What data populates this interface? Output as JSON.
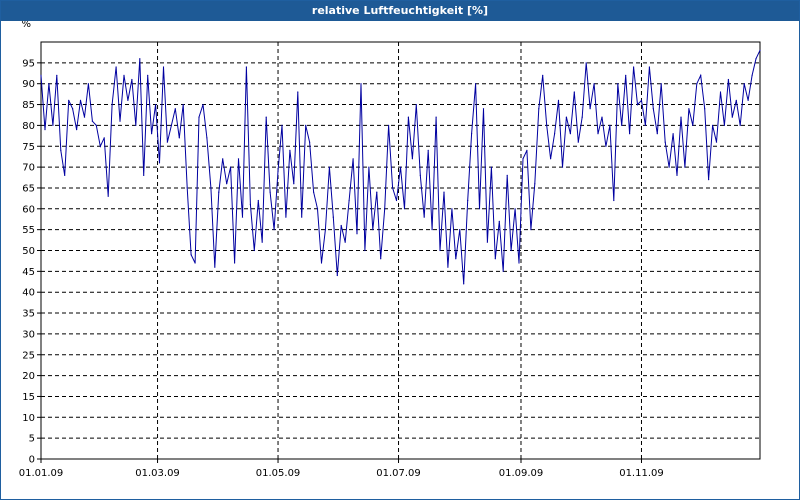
{
  "window": {
    "title": "relative Luftfeuchtigkeit [%]"
  },
  "chart_data": {
    "type": "line",
    "title": "relative Luftfeuchtigkeit [%]",
    "ylabel": "%",
    "xlabel": "",
    "ylim": [
      0,
      100
    ],
    "yticks": [
      0,
      5,
      10,
      15,
      20,
      25,
      30,
      35,
      40,
      45,
      50,
      55,
      60,
      65,
      70,
      75,
      80,
      85,
      90,
      95
    ],
    "xlim": [
      "2009-01-01",
      "2009-12-31"
    ],
    "xticks": [
      {
        "date": "2009-01-01",
        "label": "01.01.09"
      },
      {
        "date": "2009-03-01",
        "label": "01.03.09"
      },
      {
        "date": "2009-05-01",
        "label": "01.05.09"
      },
      {
        "date": "2009-07-01",
        "label": "01.07.09"
      },
      {
        "date": "2009-09-01",
        "label": "01.09.09"
      },
      {
        "date": "2009-11-01",
        "label": "01.11.09"
      }
    ],
    "grid": {
      "horizontal": true,
      "vertical": true,
      "style": "dashed"
    },
    "line_color": "#0000a0",
    "series": [
      {
        "values": [
          [
            "2009-01-01",
            92
          ],
          [
            "2009-01-03",
            79
          ],
          [
            "2009-01-05",
            90
          ],
          [
            "2009-01-07",
            80
          ],
          [
            "2009-01-09",
            92
          ],
          [
            "2009-01-11",
            74
          ],
          [
            "2009-01-13",
            68
          ],
          [
            "2009-01-15",
            86
          ],
          [
            "2009-01-17",
            84
          ],
          [
            "2009-01-19",
            79
          ],
          [
            "2009-01-21",
            86
          ],
          [
            "2009-01-23",
            82
          ],
          [
            "2009-01-25",
            90
          ],
          [
            "2009-01-27",
            81
          ],
          [
            "2009-01-29",
            80
          ],
          [
            "2009-01-31",
            75
          ],
          [
            "2009-02-02",
            77
          ],
          [
            "2009-02-04",
            63
          ],
          [
            "2009-02-06",
            85
          ],
          [
            "2009-02-08",
            94
          ],
          [
            "2009-02-10",
            81
          ],
          [
            "2009-02-12",
            92
          ],
          [
            "2009-02-14",
            86
          ],
          [
            "2009-02-16",
            91
          ],
          [
            "2009-02-18",
            80
          ],
          [
            "2009-02-20",
            96
          ],
          [
            "2009-02-22",
            68
          ],
          [
            "2009-02-24",
            92
          ],
          [
            "2009-02-26",
            78
          ],
          [
            "2009-02-28",
            85
          ],
          [
            "2009-03-02",
            71
          ],
          [
            "2009-03-04",
            94
          ],
          [
            "2009-03-06",
            76
          ],
          [
            "2009-03-08",
            80
          ],
          [
            "2009-03-10",
            84
          ],
          [
            "2009-03-12",
            77
          ],
          [
            "2009-03-14",
            85
          ],
          [
            "2009-03-16",
            65
          ],
          [
            "2009-03-18",
            49
          ],
          [
            "2009-03-20",
            47
          ],
          [
            "2009-03-22",
            82
          ],
          [
            "2009-03-24",
            85
          ],
          [
            "2009-03-26",
            77
          ],
          [
            "2009-03-28",
            65
          ],
          [
            "2009-03-30",
            46
          ],
          [
            "2009-04-01",
            64
          ],
          [
            "2009-04-03",
            72
          ],
          [
            "2009-04-05",
            66
          ],
          [
            "2009-04-07",
            70
          ],
          [
            "2009-04-09",
            47
          ],
          [
            "2009-04-11",
            72
          ],
          [
            "2009-04-13",
            58
          ],
          [
            "2009-04-15",
            94
          ],
          [
            "2009-04-17",
            61
          ],
          [
            "2009-04-19",
            50
          ],
          [
            "2009-04-21",
            62
          ],
          [
            "2009-04-23",
            52
          ],
          [
            "2009-04-25",
            82
          ],
          [
            "2009-04-27",
            64
          ],
          [
            "2009-04-29",
            55
          ],
          [
            "2009-05-01",
            69
          ],
          [
            "2009-05-03",
            80
          ],
          [
            "2009-05-05",
            58
          ],
          [
            "2009-05-07",
            74
          ],
          [
            "2009-05-09",
            66
          ],
          [
            "2009-05-11",
            88
          ],
          [
            "2009-05-13",
            58
          ],
          [
            "2009-05-15",
            80
          ],
          [
            "2009-05-17",
            76
          ],
          [
            "2009-05-19",
            64
          ],
          [
            "2009-05-21",
            60
          ],
          [
            "2009-05-23",
            47
          ],
          [
            "2009-05-25",
            55
          ],
          [
            "2009-05-27",
            70
          ],
          [
            "2009-05-29",
            58
          ],
          [
            "2009-05-31",
            44
          ],
          [
            "2009-06-02",
            56
          ],
          [
            "2009-06-04",
            52
          ],
          [
            "2009-06-06",
            62
          ],
          [
            "2009-06-08",
            72
          ],
          [
            "2009-06-10",
            54
          ],
          [
            "2009-06-12",
            90
          ],
          [
            "2009-06-14",
            50
          ],
          [
            "2009-06-16",
            70
          ],
          [
            "2009-06-18",
            55
          ],
          [
            "2009-06-20",
            64
          ],
          [
            "2009-06-22",
            48
          ],
          [
            "2009-06-24",
            60
          ],
          [
            "2009-06-26",
            80
          ],
          [
            "2009-06-28",
            65
          ],
          [
            "2009-06-30",
            62
          ],
          [
            "2009-07-02",
            70
          ],
          [
            "2009-07-04",
            60
          ],
          [
            "2009-07-06",
            82
          ],
          [
            "2009-07-08",
            72
          ],
          [
            "2009-07-10",
            85
          ],
          [
            "2009-07-12",
            68
          ],
          [
            "2009-07-14",
            58
          ],
          [
            "2009-07-16",
            74
          ],
          [
            "2009-07-18",
            55
          ],
          [
            "2009-07-20",
            82
          ],
          [
            "2009-07-22",
            50
          ],
          [
            "2009-07-24",
            64
          ],
          [
            "2009-07-26",
            46
          ],
          [
            "2009-07-28",
            60
          ],
          [
            "2009-07-30",
            48
          ],
          [
            "2009-08-01",
            55
          ],
          [
            "2009-08-03",
            42
          ],
          [
            "2009-08-05",
            62
          ],
          [
            "2009-08-07",
            78
          ],
          [
            "2009-08-09",
            90
          ],
          [
            "2009-08-11",
            60
          ],
          [
            "2009-08-13",
            84
          ],
          [
            "2009-08-15",
            52
          ],
          [
            "2009-08-17",
            70
          ],
          [
            "2009-08-19",
            48
          ],
          [
            "2009-08-21",
            57
          ],
          [
            "2009-08-23",
            45
          ],
          [
            "2009-08-25",
            68
          ],
          [
            "2009-08-27",
            50
          ],
          [
            "2009-08-29",
            60
          ],
          [
            "2009-08-31",
            47
          ],
          [
            "2009-09-02",
            72
          ],
          [
            "2009-09-04",
            74
          ],
          [
            "2009-09-06",
            55
          ],
          [
            "2009-09-08",
            66
          ],
          [
            "2009-09-10",
            84
          ],
          [
            "2009-09-12",
            92
          ],
          [
            "2009-09-14",
            80
          ],
          [
            "2009-09-16",
            72
          ],
          [
            "2009-09-18",
            78
          ],
          [
            "2009-09-20",
            86
          ],
          [
            "2009-09-22",
            70
          ],
          [
            "2009-09-24",
            82
          ],
          [
            "2009-09-26",
            78
          ],
          [
            "2009-09-28",
            88
          ],
          [
            "2009-09-30",
            76
          ],
          [
            "2009-10-02",
            82
          ],
          [
            "2009-10-04",
            95
          ],
          [
            "2009-10-06",
            84
          ],
          [
            "2009-10-08",
            90
          ],
          [
            "2009-10-10",
            78
          ],
          [
            "2009-10-12",
            82
          ],
          [
            "2009-10-14",
            75
          ],
          [
            "2009-10-16",
            80
          ],
          [
            "2009-10-18",
            62
          ],
          [
            "2009-10-20",
            90
          ],
          [
            "2009-10-22",
            80
          ],
          [
            "2009-10-24",
            92
          ],
          [
            "2009-10-26",
            78
          ],
          [
            "2009-10-28",
            94
          ],
          [
            "2009-10-30",
            85
          ],
          [
            "2009-11-01",
            86
          ],
          [
            "2009-11-03",
            80
          ],
          [
            "2009-11-05",
            94
          ],
          [
            "2009-11-07",
            84
          ],
          [
            "2009-11-09",
            78
          ],
          [
            "2009-11-11",
            90
          ],
          [
            "2009-11-13",
            76
          ],
          [
            "2009-11-15",
            70
          ],
          [
            "2009-11-17",
            78
          ],
          [
            "2009-11-19",
            68
          ],
          [
            "2009-11-21",
            82
          ],
          [
            "2009-11-23",
            70
          ],
          [
            "2009-11-25",
            84
          ],
          [
            "2009-11-27",
            80
          ],
          [
            "2009-11-29",
            90
          ],
          [
            "2009-12-01",
            92
          ],
          [
            "2009-12-03",
            84
          ],
          [
            "2009-12-05",
            67
          ],
          [
            "2009-12-07",
            80
          ],
          [
            "2009-12-09",
            76
          ],
          [
            "2009-12-11",
            88
          ],
          [
            "2009-12-13",
            80
          ],
          [
            "2009-12-15",
            91
          ],
          [
            "2009-12-17",
            82
          ],
          [
            "2009-12-19",
            86
          ],
          [
            "2009-12-21",
            80
          ],
          [
            "2009-12-23",
            90
          ],
          [
            "2009-12-25",
            86
          ],
          [
            "2009-12-27",
            92
          ],
          [
            "2009-12-29",
            96
          ],
          [
            "2009-12-31",
            98
          ]
        ]
      }
    ]
  }
}
